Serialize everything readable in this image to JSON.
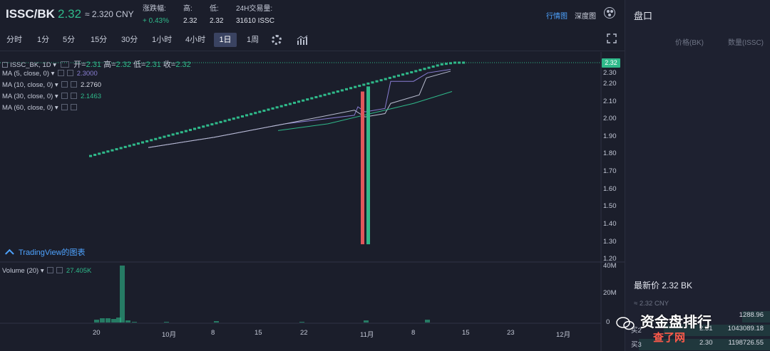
{
  "header": {
    "pair": "ISSC/BK",
    "price": "2.32",
    "cny": "≈ 2.320 CNY",
    "change_label": "涨跌幅:",
    "change_value": "+ 0.43%",
    "high_label": "高:",
    "high_value": "2.32",
    "low_label": "低:",
    "low_value": "2.32",
    "volume_label": "24H交易量:",
    "volume_value": "31610 ISSC",
    "link_market": "行情图",
    "link_depth": "深度图"
  },
  "toolbar": {
    "timeframes": [
      "分时",
      "1分",
      "5分",
      "15分",
      "30分",
      "1小时",
      "4小时",
      "1日",
      "1周"
    ],
    "active_timeframe": "1日"
  },
  "chart": {
    "series_label": "ISSC_BK, 1D ▾",
    "ohlc": {
      "open_label": "开=",
      "open": "2.31",
      "high_label": "高=",
      "high": "2.32",
      "low_label": "低=",
      "low": "2.31",
      "close_label": "收=",
      "close": "2.32"
    },
    "ma": [
      {
        "label": "MA (5, close, 0) ▾",
        "value": "2.3000",
        "color": "#8a7fd4"
      },
      {
        "label": "MA (10, close, 0) ▾",
        "value": "2.2760",
        "color": "#b9bdd0"
      },
      {
        "label": "MA (30, close, 0) ▾",
        "value": "2.1463",
        "color": "#2fb98a"
      },
      {
        "label": "MA (60, close, 0) ▾",
        "value": "",
        "color": "#8a7fd4"
      }
    ],
    "volume_label": "Volume (20) ▾",
    "volume_value": "27.405K",
    "tv_logo": "TradingView的图表",
    "last_price_tag": "2.32",
    "y_ticks": [
      "2.30",
      "2.20",
      "2.10",
      "2.00",
      "1.90",
      "1.80",
      "1.70",
      "1.60",
      "1.50",
      "1.40",
      "1.30",
      "1.20"
    ],
    "vol_ticks": [
      "40M",
      "20M",
      "0"
    ],
    "x_ticks": [
      "20",
      "10月",
      "8",
      "15",
      "22",
      "11月",
      "8",
      "15",
      "23",
      "12月"
    ],
    "colors": {
      "up": "#2fb98a",
      "down": "#e0565b",
      "ma30": "#2fb98a"
    }
  },
  "chart_data": {
    "type": "line",
    "title": "",
    "xlabel": "",
    "ylabel": "",
    "ylim": [
      1.2,
      2.32
    ],
    "series": [
      {
        "name": "ISSC_BK, 1D",
        "values": [
          1.77,
          1.79,
          1.81,
          1.83,
          1.85,
          1.87,
          1.89,
          1.91,
          1.93,
          1.95,
          1.97,
          1.99,
          2.01,
          2.03,
          2.05,
          2.07,
          2.09,
          2.11,
          2.13,
          2.15,
          2.17,
          2.19,
          2.21,
          2.23,
          2.25,
          2.27,
          2.29,
          2.31,
          2.32
        ]
      }
    ],
    "spike": {
      "low": 1.25,
      "high": 2.18
    }
  },
  "panel": {
    "title": "盘口",
    "col_price": "价格(BK)",
    "col_qty": "数量(ISSC)",
    "last_price": "最新价 2.32 BK",
    "last_cny": "≈ 2.32 CNY",
    "rows": [
      {
        "side": "",
        "price": "",
        "qty": "1288.96"
      },
      {
        "side": "买2",
        "price": "2.31",
        "qty": "1043089.18"
      },
      {
        "side": "买3",
        "price": "2.30",
        "qty": "1198726.55"
      }
    ]
  },
  "watermark": {
    "text": "资金盘排行",
    "sub": "查了网"
  }
}
